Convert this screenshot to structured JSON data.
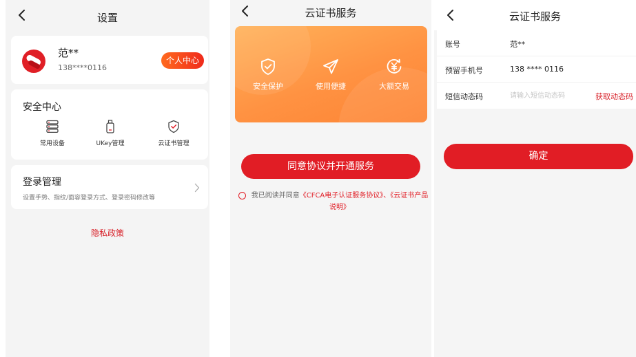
{
  "colors": {
    "primary_red": "#e11d25",
    "banner_orange": "#ff9242",
    "page_bg": "#f4f4f4"
  },
  "settings": {
    "title": "设置",
    "user": {
      "name": "范**",
      "phone": "138****0116",
      "center_button": "个人中心"
    },
    "security": {
      "title": "安全中心",
      "items": [
        {
          "label": "常用设备",
          "icon": "device-icon"
        },
        {
          "label": "UKey管理",
          "icon": "ukey-icon"
        },
        {
          "label": "云证书管理",
          "icon": "shield-check-icon"
        }
      ]
    },
    "login": {
      "title": "登录管理",
      "desc": "设置手势、指纹/面容登录方式、登录密码修改等"
    },
    "privacy": "隐私政策"
  },
  "cloud_cert": {
    "title": "云证书服务",
    "features": [
      {
        "label": "安全保护",
        "icon": "shield-check-icon"
      },
      {
        "label": "使用便捷",
        "icon": "paper-plane-icon"
      },
      {
        "label": "大额交易",
        "icon": "yuan-refresh-icon"
      }
    ],
    "agree_button": "同意协议并开通服务",
    "agreement": {
      "prefix": "我已阅读并同意",
      "link1": "《CFCA电子认证服务协议》",
      "separator": "、",
      "link2": "《云证书产品说明》"
    }
  },
  "cert_form": {
    "title": "云证书服务",
    "account_label": "账号",
    "account_value": "范**",
    "phone_label": "预留手机号",
    "phone_value": "138 **** 0116",
    "sms_label": "短信动态码",
    "sms_placeholder": "请输入短信动态码",
    "get_code": "获取动态码",
    "confirm": "确定"
  }
}
